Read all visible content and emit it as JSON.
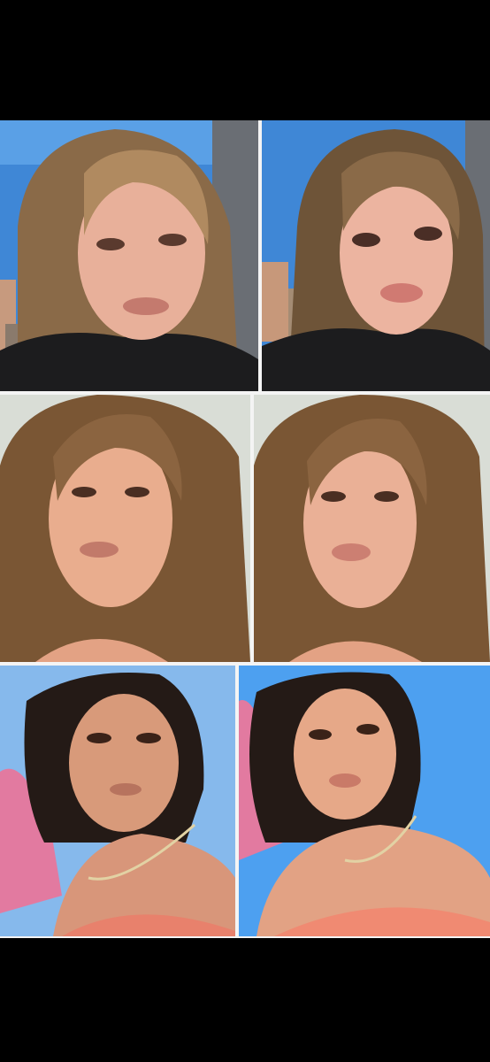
{
  "collage": {
    "rows": 3,
    "columns": 2,
    "photos": [
      {
        "scene": "city-window-selfie",
        "edit": "original",
        "background": "#4a8fd8"
      },
      {
        "scene": "city-window-selfie",
        "edit": "edited",
        "background": "#4a8fd8"
      },
      {
        "scene": "curtain-selfie",
        "edit": "original",
        "background": "#d9ddd6"
      },
      {
        "scene": "curtain-selfie",
        "edit": "edited",
        "background": "#d9ddd6"
      },
      {
        "scene": "sky-swimsuit-selfie",
        "edit": "original",
        "background": "#86b9ec"
      },
      {
        "scene": "sky-swimsuit-selfie",
        "edit": "edited",
        "background": "#4da0f0"
      }
    ]
  }
}
